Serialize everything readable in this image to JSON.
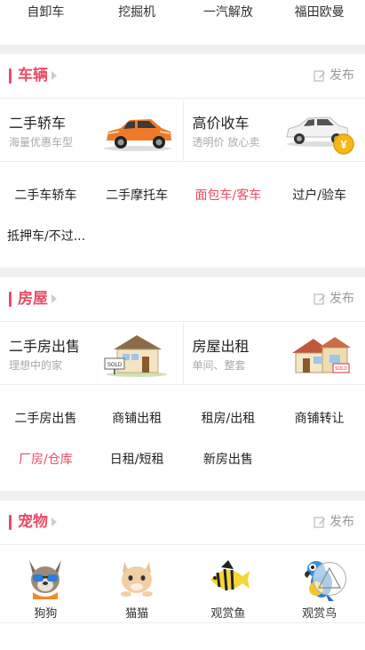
{
  "top_links": [
    "自卸车",
    "挖掘机",
    "一汽解放",
    "福田欧曼"
  ],
  "colors": {
    "accent": "#e94c65",
    "divider": "#f0f0f0",
    "muted": "#999999"
  },
  "publish_label": "发布",
  "sections": {
    "vehicles": {
      "title": "车辆",
      "cards": [
        {
          "title": "二手轿车",
          "subtitle": "海量优惠车型",
          "icon": "orange-car-icon"
        },
        {
          "title": "高价收车",
          "subtitle": "透明价 放心卖",
          "icon": "white-car-coin-icon"
        }
      ],
      "links": [
        "二手车轿车",
        "二手摩托车",
        "面包车/客车",
        "过户/验车",
        "抵押车/不过..."
      ],
      "highlight_index": 2
    },
    "housing": {
      "title": "房屋",
      "cards": [
        {
          "title": "二手房出售",
          "subtitle": "理想中的家",
          "icon": "house-sold-icon"
        },
        {
          "title": "房屋出租",
          "subtitle": "单间、整套",
          "icon": "house-rent-icon"
        }
      ],
      "links": [
        "二手房出售",
        "商铺出租",
        "租房/出租",
        "商铺转让",
        "厂房/仓库",
        "日租/短租",
        "新房出售"
      ],
      "highlight_index": 4
    },
    "pets": {
      "title": "宠物",
      "items": [
        {
          "label": "狗狗",
          "icon": "dog-icon"
        },
        {
          "label": "猫猫",
          "icon": "cat-icon"
        },
        {
          "label": "观赏鱼",
          "icon": "fish-icon"
        },
        {
          "label": "观赏鸟",
          "icon": "parrot-icon"
        }
      ]
    }
  }
}
